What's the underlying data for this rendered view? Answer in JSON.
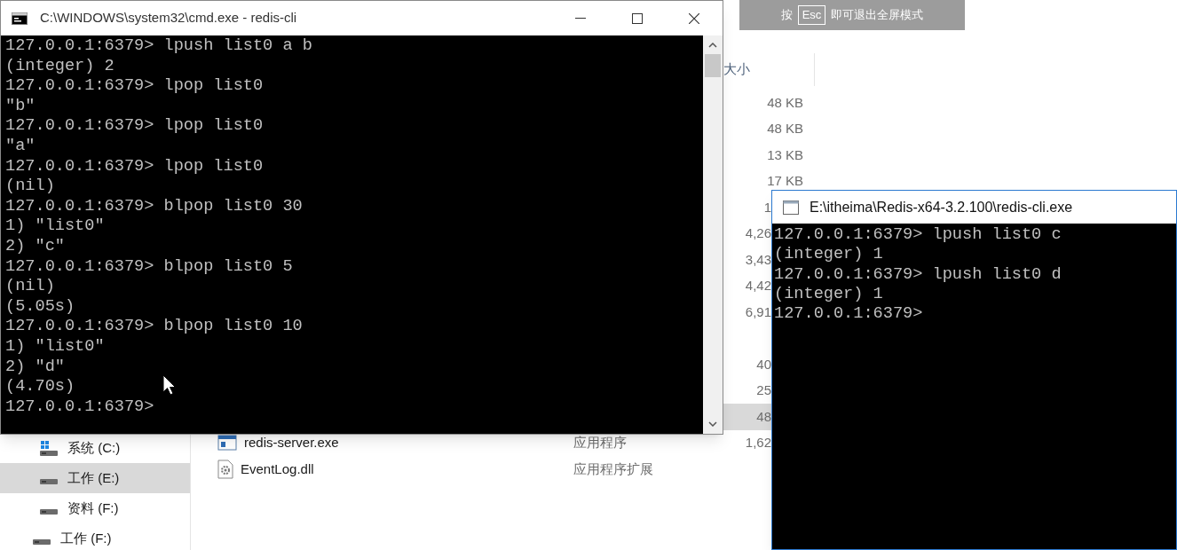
{
  "explorer": {
    "sidebar": {
      "drives": [
        {
          "label": "系统 (C:)",
          "kind": "system",
          "selected": false
        },
        {
          "label": "工作 (E:)",
          "kind": "drive",
          "selected": true
        },
        {
          "label": "资料 (F:)",
          "kind": "drive",
          "selected": false
        }
      ],
      "more_drives": [
        {
          "label": "工作 (F:)",
          "kind": "drive",
          "selected": false
        }
      ]
    },
    "columns": {
      "size": "大小"
    },
    "rows": [
      {
        "size": "48 KB",
        "partly_hidden": false,
        "selected": false
      },
      {
        "size": "48 KB",
        "partly_hidden": false,
        "selected": false
      },
      {
        "size": "13 KB",
        "partly_hidden": false,
        "selected": false
      },
      {
        "size": "17 KB",
        "partly_hidden": false,
        "selected": false
      },
      {
        "size": "1",
        "partly_hidden": true,
        "selected": false
      },
      {
        "size": "4,26",
        "partly_hidden": true,
        "selected": false
      },
      {
        "size": "3,43",
        "partly_hidden": true,
        "selected": false
      },
      {
        "size": "4,42",
        "partly_hidden": true,
        "selected": false
      },
      {
        "size": "6,91",
        "partly_hidden": true,
        "selected": false
      },
      {
        "selected": false
      },
      {
        "size": "40",
        "partly_hidden": true,
        "selected": false
      },
      {
        "size": "25",
        "partly_hidden": true,
        "selected": false
      },
      {
        "size": "48",
        "partly_hidden": true,
        "selected": true
      },
      {
        "name": "redis-server.exe",
        "kind": "exe",
        "type": "应用程序",
        "size": "1,62",
        "partly_hidden": true,
        "selected": false
      },
      {
        "name": "EventLog.dll",
        "kind": "dll",
        "type": "应用程序扩展",
        "selected": false
      }
    ]
  },
  "fullscreen_hint": {
    "before": "按",
    "key": "Esc",
    "after": "即可退出全屏模式"
  },
  "windows": [
    {
      "kind": "cmd",
      "title": "C:\\WINDOWS\\system32\\cmd.exe - redis-cli",
      "lines": [
        "127.0.0.1:6379> lpush list0 a b",
        "(integer) 2",
        "127.0.0.1:6379> lpop list0",
        "\"b\"",
        "127.0.0.1:6379> lpop list0",
        "\"a\"",
        "127.0.0.1:6379> lpop list0",
        "(nil)",
        "127.0.0.1:6379> blpop list0 30",
        "1) \"list0\"",
        "2) \"c\"",
        "127.0.0.1:6379> blpop list0 5",
        "(nil)",
        "(5.05s)",
        "127.0.0.1:6379> blpop list0 10",
        "1) \"list0\"",
        "2) \"d\"",
        "(4.70s)",
        "127.0.0.1:6379>"
      ]
    },
    {
      "kind": "redis",
      "title": "E:\\itheima\\Redis-x64-3.2.100\\redis-cli.exe",
      "lines": [
        "127.0.0.1:6379> lpush list0 c",
        "(integer) 1",
        "127.0.0.1:6379> lpush list0 d",
        "(integer) 1",
        "127.0.0.1:6379>"
      ]
    }
  ]
}
